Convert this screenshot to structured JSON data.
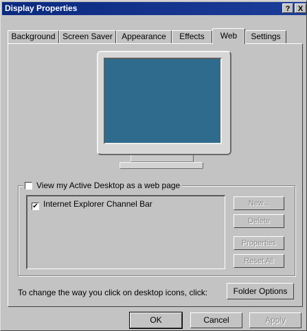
{
  "window": {
    "title": "Display Properties",
    "help_glyph": "?",
    "close_glyph": "X"
  },
  "tabs": [
    {
      "label": "Background"
    },
    {
      "label": "Screen Saver"
    },
    {
      "label": "Appearance"
    },
    {
      "label": "Effects"
    },
    {
      "label": "Web",
      "active": true
    },
    {
      "label": "Settings"
    }
  ],
  "web": {
    "active_desktop_label": "View my Active Desktop as a web page",
    "active_desktop_checked": false,
    "items": [
      {
        "label": "Internet Explorer Channel Bar",
        "checked": true,
        "check_glyph": "✔"
      }
    ],
    "buttons": {
      "new": "New...",
      "delete": "Delete",
      "properties": "Properties",
      "reset_all": "Reset All"
    },
    "hint": "To change the way you click on desktop icons, click:",
    "folder_options": "Folder Options"
  },
  "footer": {
    "ok": "OK",
    "cancel": "Cancel",
    "apply": "Apply"
  },
  "colors": {
    "titlebar": "#0a2a7e",
    "face": "#c3c3c3",
    "monitor_screen": "#2f6b8c"
  }
}
